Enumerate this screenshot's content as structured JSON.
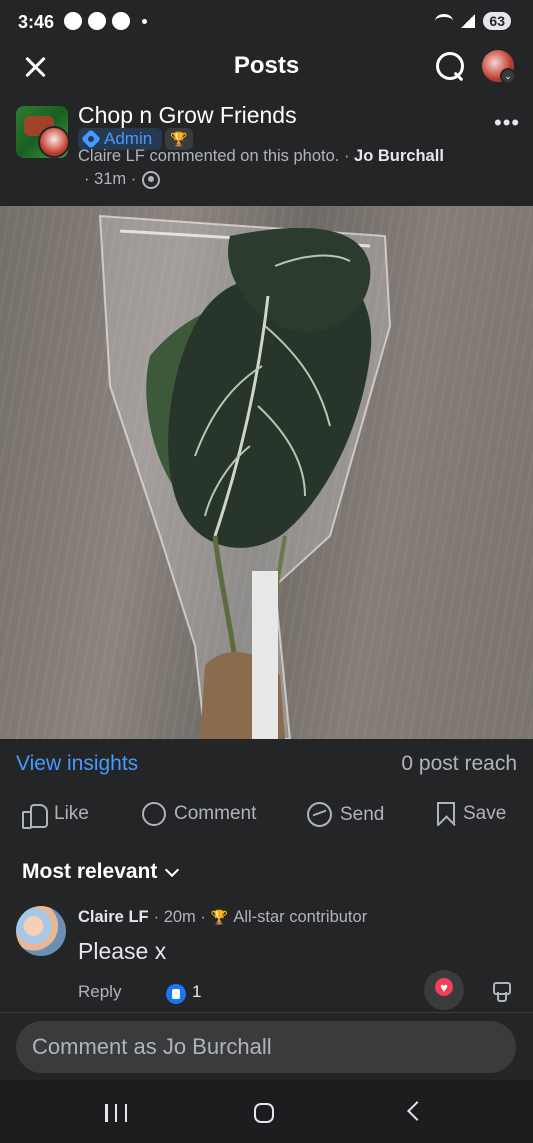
{
  "status_bar": {
    "time": "3:46",
    "battery": "63"
  },
  "nav": {
    "title": "Posts"
  },
  "post": {
    "group_name": "Chop n Grow Friends",
    "admin_label": "Admin",
    "activity_text": "Claire LF commented on this photo. · ",
    "author": "Jo Burchall",
    "time": "· 31m ·",
    "photo_label": "Anthurium clarinervium"
  },
  "insights": {
    "view_label": "View insights",
    "reach": "0 post reach"
  },
  "actions": {
    "like": "Like",
    "comment": "Comment",
    "send": "Send",
    "save": "Save"
  },
  "comments_sort": {
    "label": "Most relevant"
  },
  "comment": {
    "author": "Claire LF",
    "time": "· 20m ·",
    "badge": "All-star contributor",
    "text": "Please x",
    "reply_label": "Reply",
    "like_count": "1"
  },
  "composer": {
    "placeholder": "Comment as Jo Burchall"
  },
  "colors": {
    "background": "#242526",
    "accent": "#4599ff",
    "love": "#f33e58"
  }
}
